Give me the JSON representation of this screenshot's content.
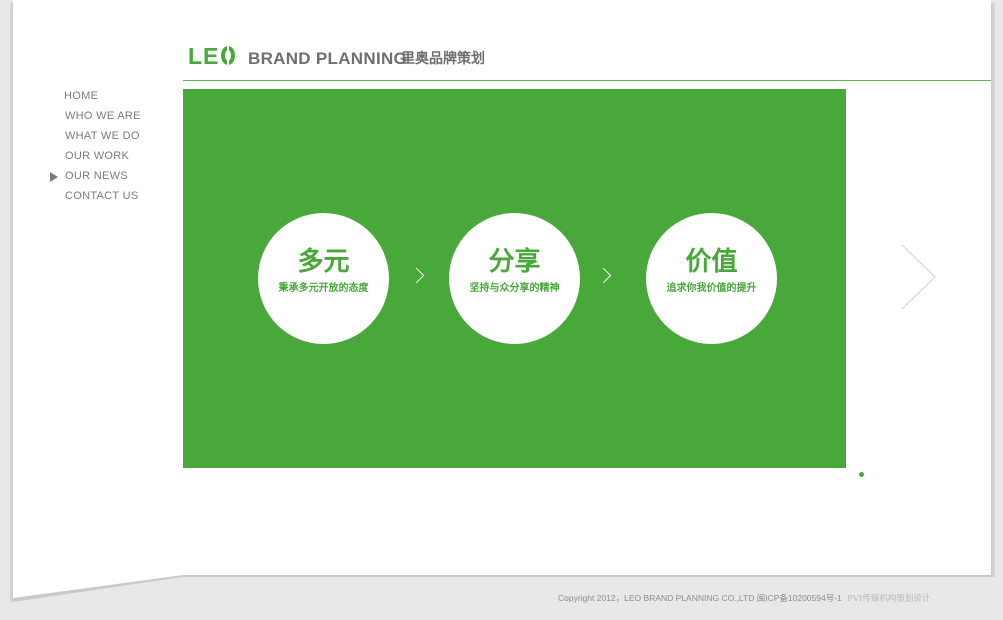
{
  "header": {
    "logo_text": "LE",
    "brand_name": "BRAND PLANNING",
    "brand_name_cn": "里奥品牌策划"
  },
  "nav": {
    "items": [
      {
        "label": "HOME",
        "active": false
      },
      {
        "label": "WHO WE ARE",
        "active": false
      },
      {
        "label": "WHAT WE DO",
        "active": false
      },
      {
        "label": "OUR WORK",
        "active": false
      },
      {
        "label": "OUR NEWS",
        "active": true
      },
      {
        "label": "CONTACT US",
        "active": false
      }
    ]
  },
  "banner": {
    "values": [
      {
        "title": "多元",
        "subtitle": "秉承多元开放的态度"
      },
      {
        "title": "分享",
        "subtitle": "坚持与众分享的精神"
      },
      {
        "title": "价值",
        "subtitle": "追求你我价值的提升"
      }
    ]
  },
  "footer": {
    "copyright": "Copyright 2012，LEO BRAND  PLANNING CO.,LTD 闽ICP备10200594号-1",
    "designer": "PVI传媒机构策划设计"
  },
  "colors": {
    "brand_green": "#49a83a",
    "text_gray": "#7b7b7b",
    "background": "#e7e8e9"
  }
}
